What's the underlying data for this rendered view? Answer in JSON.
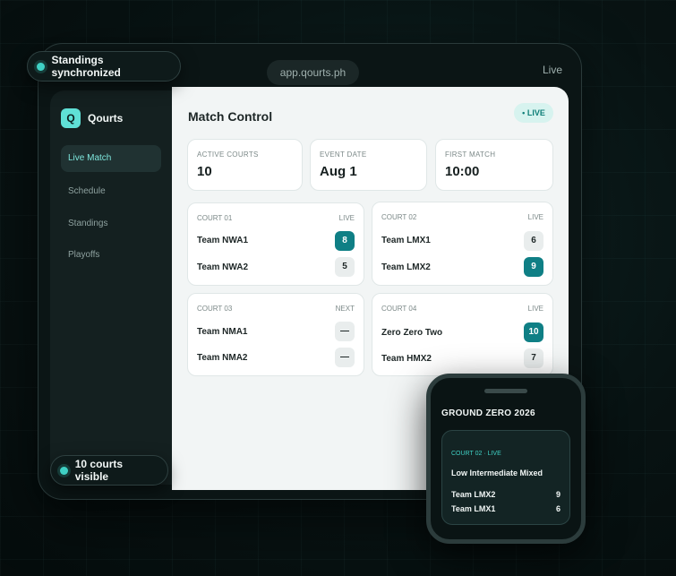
{
  "top": {
    "status_pill": "Standings synchronized",
    "url": "app.qourts.ph",
    "status_right": "Live",
    "courts_pill": "10 courts visible"
  },
  "sidebar": {
    "brand_icon": "Q",
    "brand_name": "Qourts",
    "items": [
      {
        "label": "Live Match",
        "active": true
      },
      {
        "label": "Schedule"
      },
      {
        "label": "Standings"
      },
      {
        "label": "Playoffs"
      }
    ]
  },
  "main": {
    "title": "Match Control",
    "live_badge": "• LIVE",
    "stats": [
      {
        "label": "ACTIVE COURTS",
        "value": "10"
      },
      {
        "label": "EVENT DATE",
        "value": "Aug 1"
      },
      {
        "label": "FIRST MATCH",
        "value": "10:00"
      }
    ],
    "courts": [
      {
        "name": "COURT 01",
        "status": "LIVE",
        "teams": [
          {
            "name": "Team NWA1",
            "score": "8"
          },
          {
            "name": "Team NWA2",
            "score": "5"
          }
        ]
      },
      {
        "name": "COURT 02",
        "status": "LIVE",
        "teams": [
          {
            "name": "Team LMX1",
            "score": "6"
          },
          {
            "name": "Team LMX2",
            "score": "9"
          }
        ]
      },
      {
        "name": "COURT 03",
        "status": "NEXT",
        "teams": [
          {
            "name": "Team NMA1",
            "score": "—"
          },
          {
            "name": "Team NMA2",
            "score": "—"
          }
        ]
      },
      {
        "name": "COURT 04",
        "status": "LIVE",
        "teams": [
          {
            "name": "Zero Zero Two",
            "score": "10"
          },
          {
            "name": "Team HMX2",
            "score": "7"
          }
        ]
      }
    ]
  },
  "watch": {
    "title": "GROUND ZERO 2026",
    "court_label": "COURT 02 · LIVE",
    "division": "Low Intermediate Mixed",
    "teams": [
      {
        "name": "Team LMX2",
        "score": "9"
      },
      {
        "name": "Team LMX1",
        "score": "6"
      }
    ]
  },
  "colors": {
    "accent": "#3fd0c4",
    "win_score": "#0f7f85",
    "background": "#081313"
  }
}
